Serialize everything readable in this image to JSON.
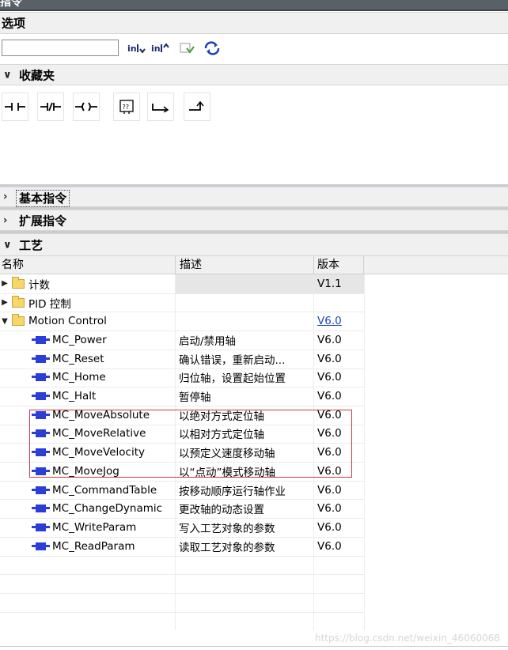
{
  "window": {
    "title": "指令"
  },
  "options": {
    "title": "选项",
    "search": {
      "value": "",
      "placeholder": ""
    }
  },
  "toolbar": {
    "buttons": [
      {
        "icon": "expand-all-icon",
        "text": "in"
      },
      {
        "icon": "collapse-all-icon",
        "text": "in"
      },
      {
        "icon": "version-icon",
        "text": ""
      },
      {
        "icon": "update-icon",
        "text": ""
      }
    ]
  },
  "favorites": {
    "title": "收藏夹",
    "items": [
      {
        "symbol": "⊣⊢",
        "icon": "no-contact-icon"
      },
      {
        "symbol": "⊣/⊢",
        "icon": "nc-contact-icon"
      },
      {
        "symbol": "–( )–",
        "icon": "coil-icon"
      },
      {
        "symbol": "??",
        "icon": "empty-box-icon"
      },
      {
        "symbol": "↦",
        "icon": "open-branch-icon"
      },
      {
        "symbol": "↱",
        "icon": "close-branch-icon"
      }
    ]
  },
  "sections": {
    "basic": "基本指令",
    "extended": "扩展指令",
    "technology": "工艺"
  },
  "table": {
    "headers": {
      "name": "名称",
      "description": "描述",
      "version": "版本"
    },
    "rows": [
      {
        "type": "folder",
        "expand": "collapsed",
        "name": "计数",
        "desc": "",
        "ver": "V1.1"
      },
      {
        "type": "folder",
        "expand": "collapsed",
        "name": "PID 控制",
        "desc": "",
        "ver": ""
      },
      {
        "type": "folder",
        "expand": "expanded",
        "name": "Motion Control",
        "desc": "",
        "ver": "V6.0"
      },
      {
        "type": "fb",
        "name": "MC_Power",
        "desc": "启动/禁用轴",
        "ver": "V6.0"
      },
      {
        "type": "fb",
        "name": "MC_Reset",
        "desc": "确认错误，重新启动...",
        "ver": "V6.0"
      },
      {
        "type": "fb",
        "name": "MC_Home",
        "desc": "归位轴，设置起始位置",
        "ver": "V6.0"
      },
      {
        "type": "fb",
        "name": "MC_Halt",
        "desc": "暂停轴",
        "ver": "V6.0"
      },
      {
        "type": "fb",
        "name": "MC_MoveAbsolute",
        "desc": "以绝对方式定位轴",
        "ver": "V6.0"
      },
      {
        "type": "fb",
        "name": "MC_MoveRelative",
        "desc": "以相对方式定位轴",
        "ver": "V6.0"
      },
      {
        "type": "fb",
        "name": "MC_MoveVelocity",
        "desc": "以预定义速度移动轴",
        "ver": "V6.0"
      },
      {
        "type": "fb",
        "name": "MC_MoveJog",
        "desc": "以“点动”模式移动轴",
        "ver": "V6.0"
      },
      {
        "type": "fb",
        "name": "MC_CommandTable",
        "desc": "按移动顺序运行轴作业",
        "ver": "V6.0"
      },
      {
        "type": "fb",
        "name": "MC_ChangeDynamic",
        "desc": "更改轴的动态设置",
        "ver": "V6.0"
      },
      {
        "type": "fb",
        "name": "MC_WriteParam",
        "desc": "写入工艺对象的参数",
        "ver": "V6.0"
      },
      {
        "type": "fb",
        "name": "MC_ReadParam",
        "desc": "读取工艺对象的参数",
        "ver": "V6.0"
      }
    ]
  },
  "watermark": "https://blog.csdn.net/weixin_46060068",
  "colors": {
    "highlight_box": "#d0393f",
    "link": "#1d44c4",
    "fb_icon": "#2b3fd6",
    "folder": "#f7d66a"
  }
}
